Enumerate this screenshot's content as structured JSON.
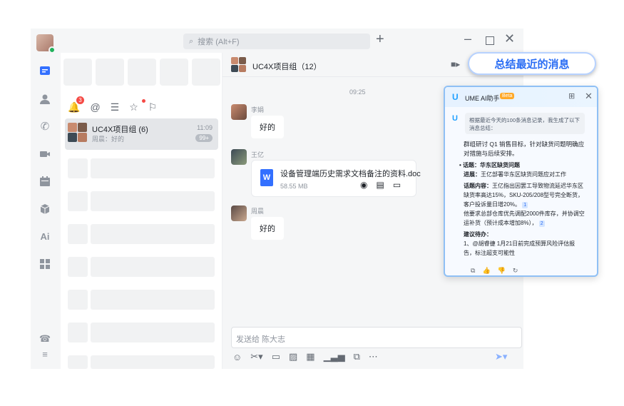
{
  "search": {
    "placeholder": "搜索 (Alt+F)"
  },
  "filters": {
    "unread_badge": "3"
  },
  "chat_list": [
    {
      "name": "UC4X项目组 (6)",
      "time": "11:09",
      "last": "周晨：好的",
      "badge": "99+"
    }
  ],
  "conversation": {
    "title": "UC4X项目组（12）",
    "time": "09:25",
    "messages": [
      {
        "sender": "李娟",
        "text": "好的"
      },
      {
        "sender": "王亿",
        "file_name": "设备管理端历史需求文档备注的资料.doc",
        "file_size": "58.55 MB"
      },
      {
        "sender": "周晨",
        "text": "好的"
      }
    ],
    "input_placeholder": "发送给 陈大志"
  },
  "tooltip": {
    "text": "总结最近的消息"
  },
  "ai_panel": {
    "title": "UME AI助手",
    "beta": "Beta",
    "intro": "根据最近今天的100条消息记录，我生成了以下消息总结：",
    "summary": "群组研讨 Q1 销售目标，针对缺货问题明确应对措施与后续安排。",
    "topic_label": "• 话题：华东区缺货问题",
    "progress_label": "进展：",
    "progress": "王亿部署华东区缺货问题应对工作",
    "content_label": "话题内容：",
    "content": "王亿指出因罢工导致物流延迟华东区缺货率高达15%，SKU-205/208型号完全断货，客户投诉量日增20%。",
    "ref1": "1",
    "content2": "他要求总部仓库优先调配2000件库存，并协调空运补货（预计成本增加8%），",
    "ref2": "2",
    "todo_label": "建议待办：",
    "todo": "1、@胡睿捷 1月21日前完成预算风险评估报告，标注超支可能性"
  },
  "colors": {
    "accent": "#3370ff",
    "ai_border": "#8fc0f5",
    "badge_red": "#f54a45"
  }
}
